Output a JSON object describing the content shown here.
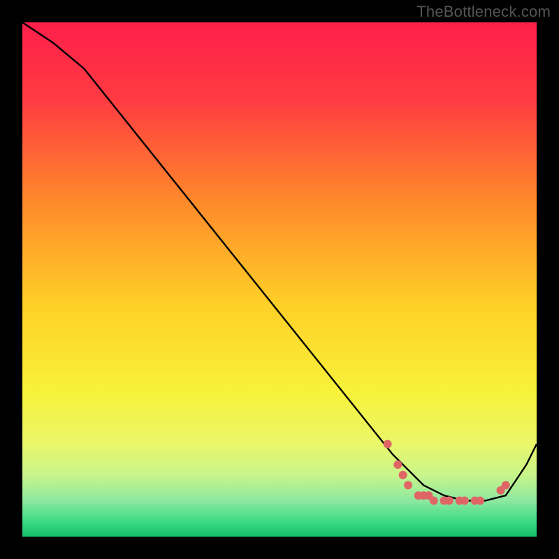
{
  "watermark": "TheBottleneck.com",
  "chart_data": {
    "type": "line",
    "title": "",
    "xlabel": "",
    "ylabel": "",
    "xlim": [
      0,
      100
    ],
    "ylim": [
      0,
      100
    ],
    "curve": {
      "name": "bottleneck-curve",
      "x": [
        0,
        6,
        12,
        72,
        78,
        82,
        86,
        90,
        94,
        98,
        100
      ],
      "y": [
        100,
        96,
        91,
        16,
        10,
        8,
        7,
        7,
        8,
        14,
        18
      ]
    },
    "markers": {
      "name": "data-points",
      "color": "#e06666",
      "x": [
        71,
        73,
        74,
        75,
        77,
        78,
        79,
        80,
        82,
        83,
        85,
        86,
        88,
        89,
        93,
        94
      ],
      "y": [
        18,
        14,
        12,
        10,
        8,
        8,
        8,
        7,
        7,
        7,
        7,
        7,
        7,
        7,
        9,
        10
      ]
    },
    "gradient_stops": [
      {
        "offset": 0.0,
        "color": "#ff1f4a"
      },
      {
        "offset": 0.15,
        "color": "#ff3b42"
      },
      {
        "offset": 0.35,
        "color": "#ff8a2a"
      },
      {
        "offset": 0.55,
        "color": "#ffd028"
      },
      {
        "offset": 0.72,
        "color": "#f7f23a"
      },
      {
        "offset": 0.82,
        "color": "#eaf76a"
      },
      {
        "offset": 0.88,
        "color": "#c8f58a"
      },
      {
        "offset": 0.93,
        "color": "#8de8a0"
      },
      {
        "offset": 0.97,
        "color": "#3ddc84"
      },
      {
        "offset": 1.0,
        "color": "#16c06a"
      }
    ]
  }
}
